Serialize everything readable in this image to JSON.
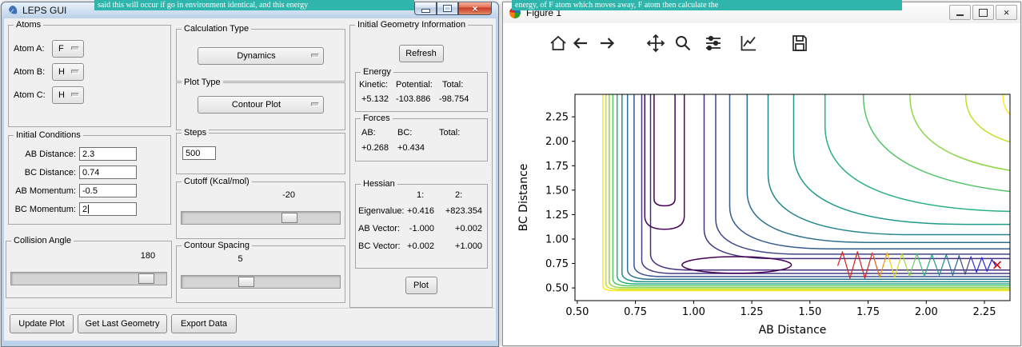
{
  "background_text": {
    "left_fragment": "said this will occur if go in environment identical, and this energy",
    "right_fragment": "energy, of F atom which moves away, F atom then calculate the",
    "highlight_color": "#2fb5ab"
  },
  "leps_window": {
    "title": "LEPS GUI",
    "atoms": {
      "label": "Atoms",
      "rows": [
        {
          "label": "Atom A:",
          "value": "F"
        },
        {
          "label": "Atom B:",
          "value": "H"
        },
        {
          "label": "Atom C:",
          "value": "H"
        }
      ]
    },
    "calculation_type": {
      "label": "Calculation Type",
      "value": "Dynamics"
    },
    "plot_type": {
      "label": "Plot Type",
      "value": "Contour Plot"
    },
    "initial_conditions": {
      "label": "Initial Conditions",
      "rows": [
        {
          "label": "AB Distance:",
          "value": "2.3"
        },
        {
          "label": "BC Distance:",
          "value": "0.74"
        },
        {
          "label": "AB Momentum:",
          "value": "-0.5"
        },
        {
          "label": "BC Momentum:",
          "value": "2"
        }
      ]
    },
    "steps": {
      "label": "Steps",
      "value": "500"
    },
    "cutoff": {
      "label": "Cutoff (Kcal/mol)",
      "value": "-20",
      "slider_pos": 0.68
    },
    "collision_angle": {
      "label": "Collision Angle",
      "value": "180",
      "slider_pos": 0.87
    },
    "contour_spacing": {
      "label": "Contour Spacing",
      "value": "5",
      "slider_pos": 0.41
    },
    "geometry_info": {
      "label": "Initial Geometry Information",
      "refresh_button": "Refresh",
      "plot_button": "Plot",
      "energy": {
        "label": "Energy",
        "headers": [
          "Kinetic:",
          "Potential:",
          "Total:"
        ],
        "values": [
          "+5.132",
          "-103.886",
          "-98.754"
        ]
      },
      "forces": {
        "label": "Forces",
        "headers": [
          "AB:",
          "BC:",
          "Total:"
        ],
        "values": [
          "+0.268",
          "+0.434",
          ""
        ]
      },
      "hessian": {
        "label": "Hessian",
        "col_headers": [
          "1:",
          "2:"
        ],
        "rows": [
          {
            "label": "Eigenvalue:",
            "v1": "+0.416",
            "v2": "+823.354"
          },
          {
            "label": "AB Vector:",
            "v1": "-1.000",
            "v2": "+0.002"
          },
          {
            "label": "BC Vector:",
            "v1": "+0.002",
            "v2": "+1.000"
          }
        ]
      }
    },
    "bottom_buttons": [
      "Update Plot",
      "Get Last Geometry",
      "Export Data"
    ]
  },
  "figure_window": {
    "title": "Figure 1",
    "toolbar_icons": [
      "home",
      "back",
      "forward",
      "pan",
      "zoom",
      "configure-subplots",
      "edit-parameters",
      "save"
    ]
  },
  "chart_data": {
    "type": "contour",
    "title": "",
    "xlabel": "AB Distance",
    "ylabel": "BC Distance",
    "xlim": [
      0.49,
      2.36
    ],
    "ylim": [
      0.37,
      2.48
    ],
    "xtick_labels": [
      "0.50",
      "0.75",
      "1.00",
      "1.25",
      "1.50",
      "1.75",
      "2.00",
      "2.25"
    ],
    "ytick_labels": [
      "0.50",
      "0.75",
      "1.00",
      "1.25",
      "1.50",
      "1.75",
      "2.00",
      "2.25"
    ],
    "colormap": "viridis",
    "grid": false,
    "wall_contours": [
      {
        "v": 0.61,
        "h": 0.472,
        "r": 0.05,
        "c": "#fde725"
      },
      {
        "v": 0.623,
        "h": 0.487,
        "r": 0.055,
        "c": "#c8e020"
      },
      {
        "v": 0.637,
        "h": 0.503,
        "r": 0.062,
        "c": "#90d743"
      },
      {
        "v": 0.653,
        "h": 0.521,
        "r": 0.07,
        "c": "#54c568"
      },
      {
        "v": 0.671,
        "h": 0.541,
        "r": 0.08,
        "c": "#28ae80"
      },
      {
        "v": 0.692,
        "h": 0.563,
        "r": 0.09,
        "c": "#21918c"
      },
      {
        "v": 0.716,
        "h": 0.588,
        "r": 0.102,
        "c": "#2c728e"
      },
      {
        "v": 0.744,
        "h": 0.616,
        "r": 0.118,
        "c": "#38588c"
      },
      {
        "v": 0.777,
        "h": 0.648,
        "r": 0.138,
        "c": "#433e85"
      },
      {
        "v": 0.815,
        "h": 0.683,
        "r": 0.165,
        "c": "#472f7d"
      }
    ],
    "plateau_contours": [
      {
        "v": 1.045,
        "h": 0.8,
        "r": 0.3,
        "c": "#46327e"
      },
      {
        "v": 1.095,
        "h": 0.845,
        "r": 0.36,
        "c": "#3f4889"
      },
      {
        "v": 1.155,
        "h": 0.9,
        "r": 0.43,
        "c": "#365c8d"
      },
      {
        "v": 1.23,
        "h": 0.965,
        "r": 0.52,
        "c": "#2d708e"
      },
      {
        "v": 1.32,
        "h": 1.045,
        "r": 0.62,
        "c": "#25858e"
      },
      {
        "v": 1.43,
        "h": 1.15,
        "r": 0.74,
        "c": "#1f998a"
      },
      {
        "v": 1.565,
        "h": 1.28,
        "r": 0.88,
        "c": "#2ab07f"
      },
      {
        "v": 1.73,
        "h": 1.44,
        "r": 1.02,
        "c": "#53c568"
      },
      {
        "v": 1.93,
        "h": 1.64,
        "r": 1.18,
        "c": "#8ed645"
      },
      {
        "v": 2.17,
        "h": 1.89,
        "r": 1.35,
        "c": "#c5e021"
      },
      {
        "v": 2.33,
        "h": 2.06,
        "r": 1.45,
        "c": "#fde725"
      }
    ],
    "valley_u_contours": [
      {
        "cx": 0.875,
        "w": 0.085,
        "yb": 1.1,
        "c": "#46085c"
      },
      {
        "cx": 0.875,
        "w": 0.045,
        "yb": 1.34,
        "c": "#440154"
      }
    ],
    "closed_contours": [
      {
        "cx": 1.185,
        "cy": 0.735,
        "rx": 0.235,
        "ry": 0.085,
        "c": "#440154"
      }
    ],
    "trajectory": {
      "points": [
        [
          1.62,
          0.73
        ],
        [
          1.64,
          0.87
        ],
        [
          1.672,
          0.6
        ],
        [
          1.704,
          0.87
        ],
        [
          1.736,
          0.6
        ],
        [
          1.768,
          0.86
        ],
        [
          1.8,
          0.61
        ],
        [
          1.832,
          0.86
        ],
        [
          1.864,
          0.61
        ],
        [
          1.896,
          0.85
        ],
        [
          1.928,
          0.62
        ],
        [
          1.96,
          0.85
        ],
        [
          1.992,
          0.62
        ],
        [
          2.024,
          0.84
        ],
        [
          2.056,
          0.63
        ],
        [
          2.086,
          0.84
        ],
        [
          2.114,
          0.63
        ],
        [
          2.141,
          0.83
        ],
        [
          2.167,
          0.64
        ],
        [
          2.192,
          0.82
        ],
        [
          2.216,
          0.66
        ],
        [
          2.239,
          0.81
        ],
        [
          2.261,
          0.67
        ],
        [
          2.282,
          0.79
        ],
        [
          2.3,
          0.72
        ]
      ],
      "segment_colors": [
        "#d62020",
        "#d62020",
        "#d62020",
        "#d62020",
        "#d62020",
        "#e25c18",
        "#ec9711",
        "#f3cd0d",
        "#d5e01a",
        "#a2db33",
        "#6bcd5a",
        "#3fbe72",
        "#27ab80",
        "#21988a",
        "#24858e",
        "#2b738e",
        "#32608d",
        "#394d89",
        "#414083",
        "#2f35cf",
        "#2a2ad5",
        "#2424da",
        "#1e1ee0",
        "#1818e6"
      ],
      "end_marker": {
        "x": 2.305,
        "y": 0.735,
        "color": "#dd0000",
        "symbol": "x"
      }
    }
  }
}
